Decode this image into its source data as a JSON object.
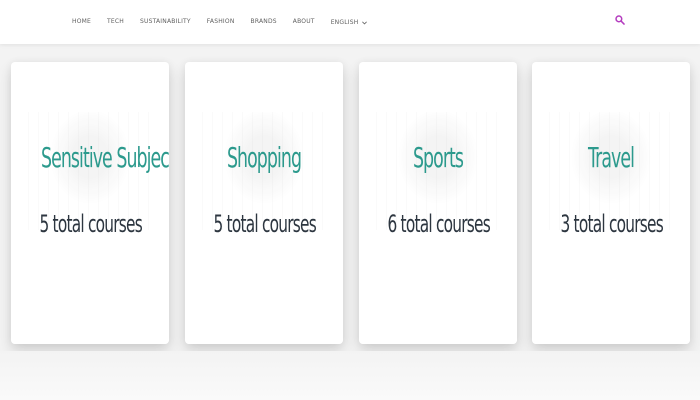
{
  "nav": {
    "items": [
      {
        "label": "HOME"
      },
      {
        "label": "TECH"
      },
      {
        "label": "SUSTAINABILITY"
      },
      {
        "label": "FASHION"
      },
      {
        "label": "BRANDS"
      },
      {
        "label": "ABOUT"
      }
    ],
    "language": "ENGLISH"
  },
  "theme": {
    "accent": "#2c9a8d",
    "search_icon_color": "#b43dbf",
    "text": "#2d3640"
  },
  "cards": [
    {
      "title": "Sensitive Subjects",
      "count": "5 total courses"
    },
    {
      "title": "Shopping",
      "count": "5 total courses"
    },
    {
      "title": "Sports",
      "count": "6 total courses"
    },
    {
      "title": "Travel",
      "count": "3 total courses"
    }
  ]
}
